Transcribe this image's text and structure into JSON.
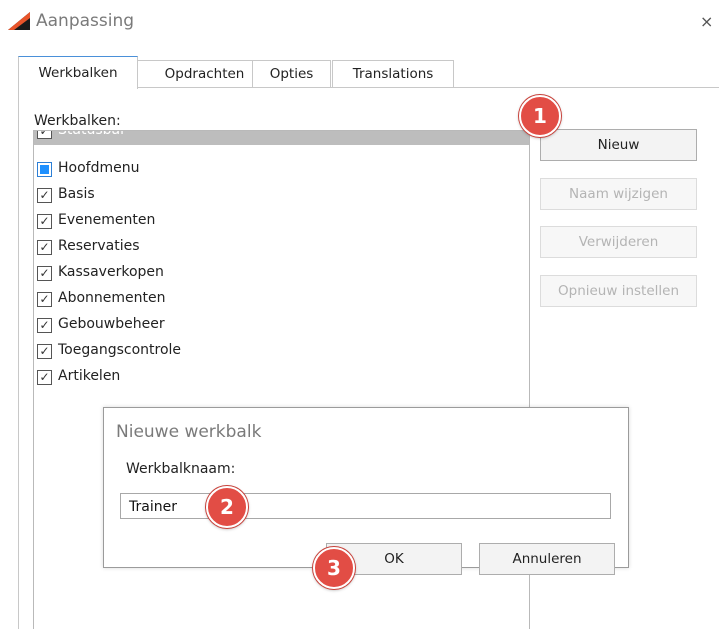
{
  "window": {
    "title": "Aanpassing",
    "close_glyph": "×",
    "logo_icon": "app-logo-icon"
  },
  "tabs": [
    {
      "label": "Werkbalken",
      "active": true
    },
    {
      "label": "Opdrachten",
      "active": false
    },
    {
      "label": "Opties",
      "active": false
    },
    {
      "label": "Translations",
      "active": false
    }
  ],
  "toolbars_panel": {
    "label": "Werkbalken:",
    "items": [
      {
        "label": "Statusbar",
        "state": "checked",
        "selected": true
      },
      {
        "label": "Hoofdmenu",
        "state": "partial",
        "selected": false
      },
      {
        "label": "Basis",
        "state": "checked",
        "selected": false
      },
      {
        "label": "Evenementen",
        "state": "checked",
        "selected": false
      },
      {
        "label": "Reservaties",
        "state": "checked",
        "selected": false
      },
      {
        "label": "Kassaverkopen",
        "state": "checked",
        "selected": false
      },
      {
        "label": "Abonnementen",
        "state": "checked",
        "selected": false
      },
      {
        "label": "Gebouwbeheer",
        "state": "checked",
        "selected": false
      },
      {
        "label": "Toegangscontrole",
        "state": "checked",
        "selected": false
      },
      {
        "label": "Artikelen",
        "state": "checked",
        "selected": false
      }
    ],
    "check_glyph": "✓"
  },
  "side_buttons": [
    {
      "label": "Nieuw",
      "enabled": true
    },
    {
      "label": "Naam wijzigen",
      "enabled": false
    },
    {
      "label": "Verwijderen",
      "enabled": false
    },
    {
      "label": "Opnieuw instellen",
      "enabled": false
    }
  ],
  "dialog": {
    "title": "Nieuwe werkbalk",
    "field_label": "Werkbalknaam:",
    "field_value": "Trainer",
    "ok_label": "OK",
    "cancel_label": "Annuleren"
  },
  "step_badges": [
    "1",
    "2",
    "3"
  ],
  "colors": {
    "badge": "#e24d45",
    "active_tab_top": "#4a90d9",
    "checkbox_partial": "#1e90ff"
  }
}
